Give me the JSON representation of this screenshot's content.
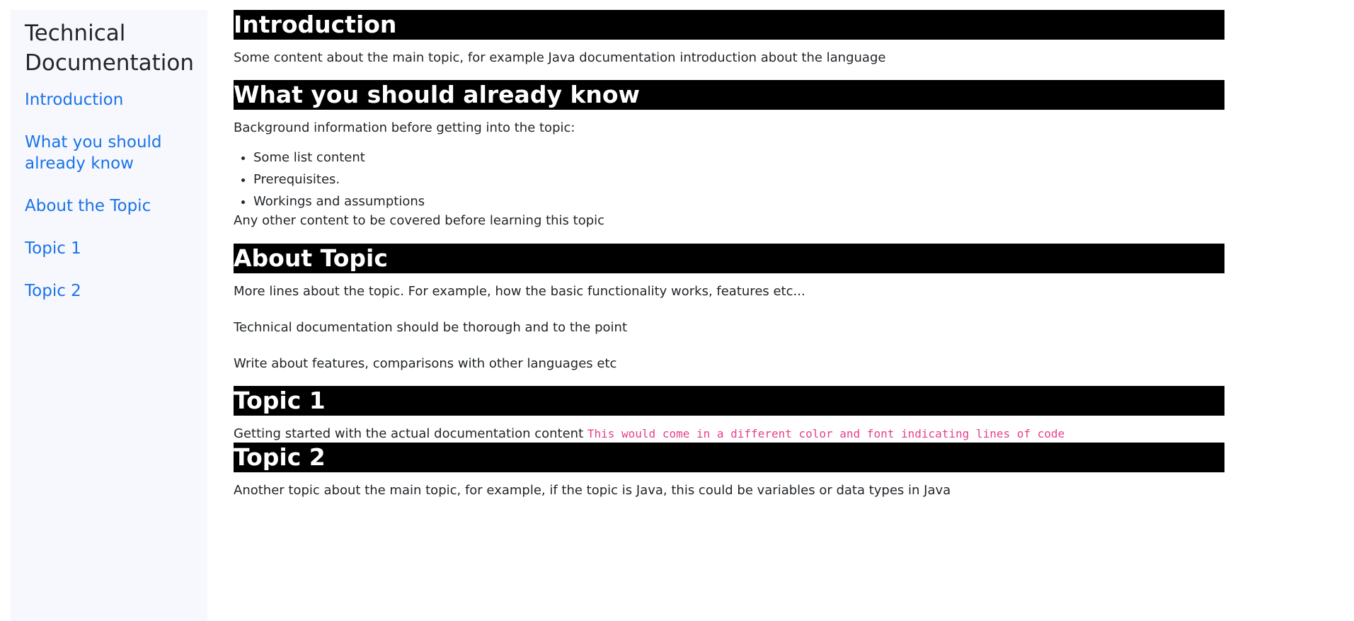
{
  "sidebar": {
    "title": "Technical Documentation",
    "items": [
      {
        "label": "Introduction"
      },
      {
        "label": "What you should already know"
      },
      {
        "label": "About the Topic"
      },
      {
        "label": "Topic 1"
      },
      {
        "label": "Topic 2"
      }
    ]
  },
  "sections": {
    "introduction": {
      "heading": "Introduction",
      "text": "Some content about the main topic, for example Java documentation introduction about the language"
    },
    "already_know": {
      "heading": "What you should already know",
      "intro": "Background information before getting into the topic:",
      "bullets": [
        "Some list content",
        "Prerequisites.",
        "Workings and assumptions"
      ],
      "outro": "Any other content to be covered before learning this topic"
    },
    "about": {
      "heading": "About Topic",
      "paragraphs": [
        "More lines about the topic. For example, how the basic functionality works, features etc...",
        "Technical documentation should be thorough and to the point",
        "Write about features, comparisons with other languages etc"
      ]
    },
    "topic1": {
      "heading": "Topic 1",
      "text": "Getting started with the actual documentation content",
      "code": "This would come in a different color and font indicating lines of code"
    },
    "topic2": {
      "heading": "Topic 2",
      "text": "Another topic about the main topic, for example, if the topic is Java, this could be variables or data types in Java"
    }
  },
  "colors": {
    "link": "#1a73e8",
    "header_bg": "#000000",
    "sidebar_bg": "#f7f8fd",
    "code": "#e83e8c"
  }
}
